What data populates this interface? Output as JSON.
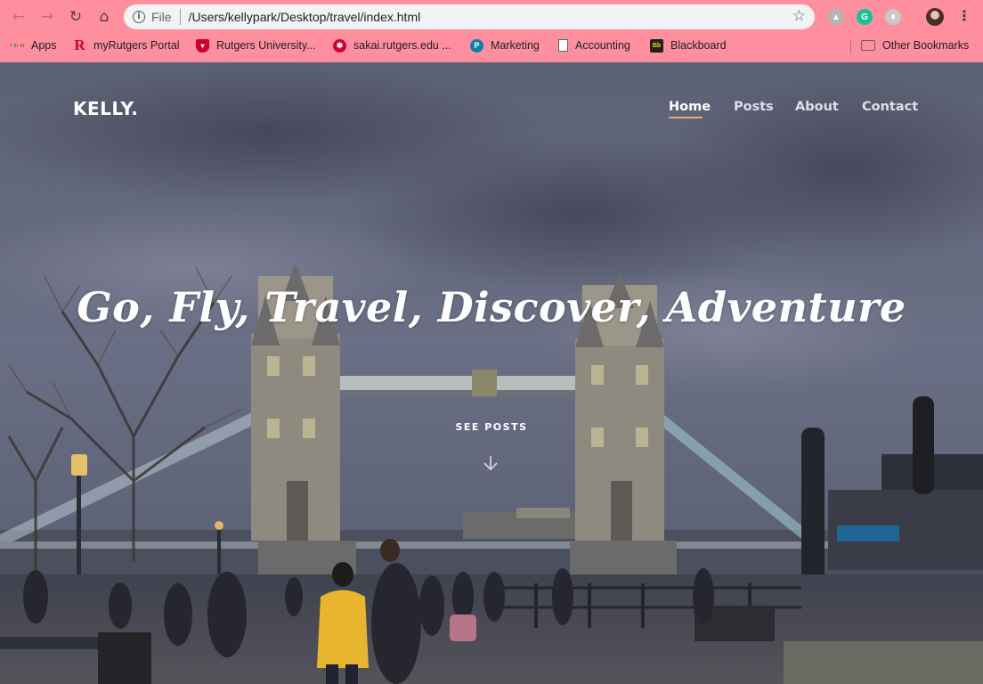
{
  "browser": {
    "file_label": "File",
    "url": "/Users/kellypark/Desktop/travel/index.html",
    "extensions": [
      "drive-icon",
      "grammarly-icon",
      "extension-icon"
    ],
    "bookmarks": [
      {
        "label": "Apps",
        "icon": "apps-grid-icon"
      },
      {
        "label": "myRutgers Portal",
        "icon": "rutgers-r-icon"
      },
      {
        "label": "Rutgers University...",
        "icon": "rutgers-shield-icon"
      },
      {
        "label": "sakai.rutgers.edu ...",
        "icon": "sakai-icon"
      },
      {
        "label": "Marketing",
        "icon": "pearson-icon"
      },
      {
        "label": "Accounting",
        "icon": "document-icon"
      },
      {
        "label": "Blackboard",
        "icon": "blackboard-icon"
      }
    ],
    "other_bookmarks": "Other Bookmarks"
  },
  "site": {
    "logo": "KELLY.",
    "nav": [
      "Home",
      "Posts",
      "About",
      "Contact"
    ],
    "active_nav": "Home",
    "headline": "Go, Fly, Travel, Discover, Adventure",
    "cta": "SEE POSTS",
    "accent_color": "#f2a47a",
    "chrome_color": "#fe8f9e"
  }
}
